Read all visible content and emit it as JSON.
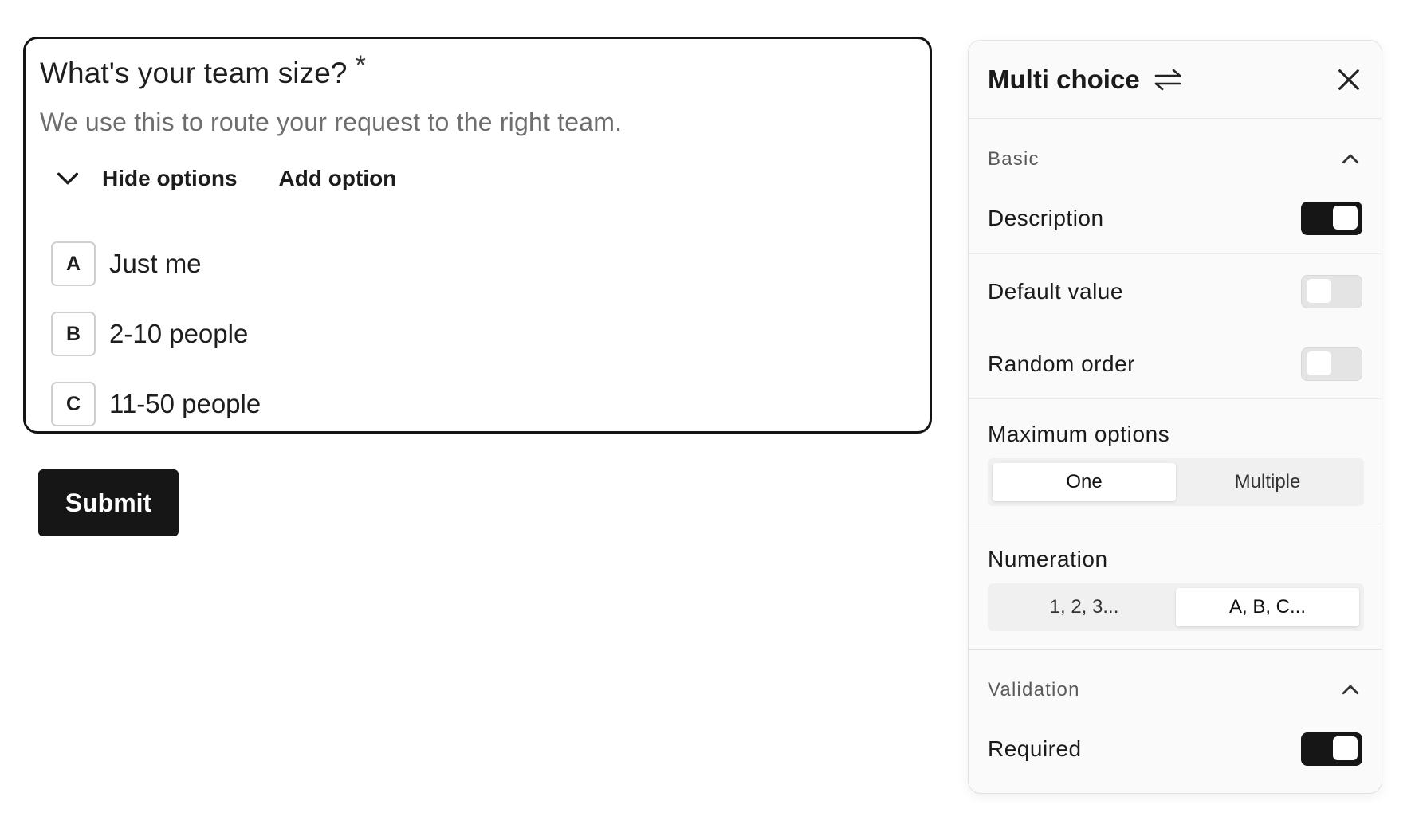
{
  "question": {
    "title": "What's your team size?",
    "required_marker": "*",
    "description": "We use this to route your request to the right team.",
    "hide_options_label": "Hide options",
    "add_option_label": "Add option",
    "options": [
      {
        "key": "A",
        "label": "Just me"
      },
      {
        "key": "B",
        "label": "2-10 people"
      },
      {
        "key": "C",
        "label": "11-50 people"
      }
    ]
  },
  "submit_label": "Submit",
  "panel": {
    "title": "Multi choice",
    "sections": {
      "basic": {
        "label": "Basic",
        "settings": [
          {
            "label": "Description",
            "enabled": true
          },
          {
            "label": "Default value",
            "enabled": false
          },
          {
            "label": "Random order",
            "enabled": false
          }
        ],
        "maximum_options": {
          "label": "Maximum options",
          "choices": [
            "One",
            "Multiple"
          ],
          "selected": "One"
        },
        "numeration": {
          "label": "Numeration",
          "choices": [
            "1, 2, 3...",
            "A, B, C..."
          ],
          "selected": "A, B, C..."
        }
      },
      "validation": {
        "label": "Validation",
        "settings": [
          {
            "label": "Required",
            "enabled": true
          }
        ]
      }
    }
  },
  "colors": {
    "primary": "#161616",
    "toggle_off": "#e4e4e4",
    "muted_text": "#6e6e6e"
  }
}
